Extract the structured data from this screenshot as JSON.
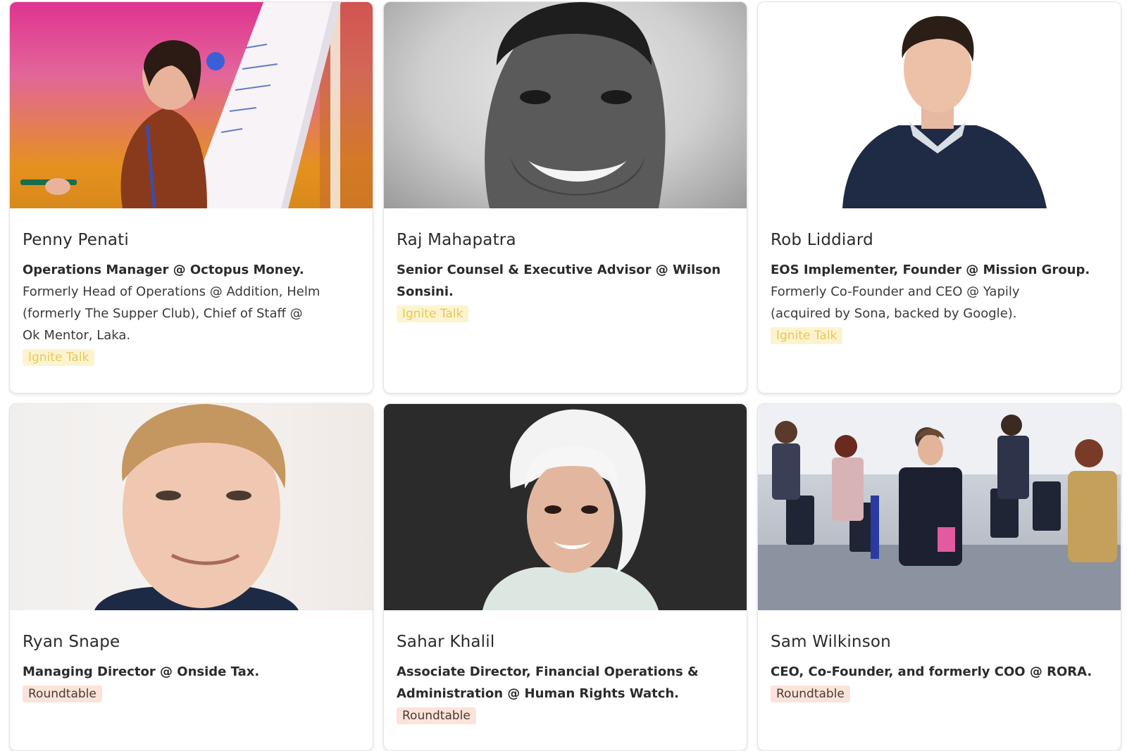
{
  "speakers": [
    {
      "name": "Penny Penati",
      "role": "Operations Manager @ Octopus Money.",
      "extra_lines": [
        "Formerly Head of Operations @ Addition, Helm",
        "(formerly The Supper Club), Chief of Staff @",
        "Ok Mentor, Laka."
      ],
      "tag": "Ignite Talk",
      "photo_icon": "person-at-flipchart-photo"
    },
    {
      "name": "Raj Mahapatra",
      "role_lines": [
        "Senior Counsel & Executive Advisor @ Wilson",
        "Sonsini."
      ],
      "tag": "Ignite Talk",
      "photo_icon": "portrait-photo"
    },
    {
      "name": "Rob Liddiard",
      "role": "EOS Implementer, Founder @ Mission Group.",
      "extra_lines": [
        "Formerly Co-Founder and CEO @ Yapily",
        "(acquired by Sona, backed by Google)."
      ],
      "tag": "Ignite Talk",
      "photo_icon": "portrait-photo"
    },
    {
      "name": "Ryan Snape",
      "role": "Managing Director @ Onside Tax.",
      "tag": "Roundtable",
      "photo_icon": "portrait-photo"
    },
    {
      "name": "Sahar Khalil",
      "role_lines": [
        "Associate Director, Financial Operations &",
        "Administration @ Human Rights Watch."
      ],
      "tag": "Roundtable",
      "photo_icon": "portrait-photo"
    },
    {
      "name": "Sam Wilkinson",
      "role": "CEO, Co-Founder, and formerly COO @ RORA.",
      "tag": "Roundtable",
      "photo_icon": "group-discussion-photo"
    }
  ],
  "colors": {
    "ignite_bg": "#fdf4cf",
    "ignite_text": "#e8c75a",
    "roundtable_bg": "#fbe3d9",
    "roundtable_text": "#4a3a35"
  }
}
